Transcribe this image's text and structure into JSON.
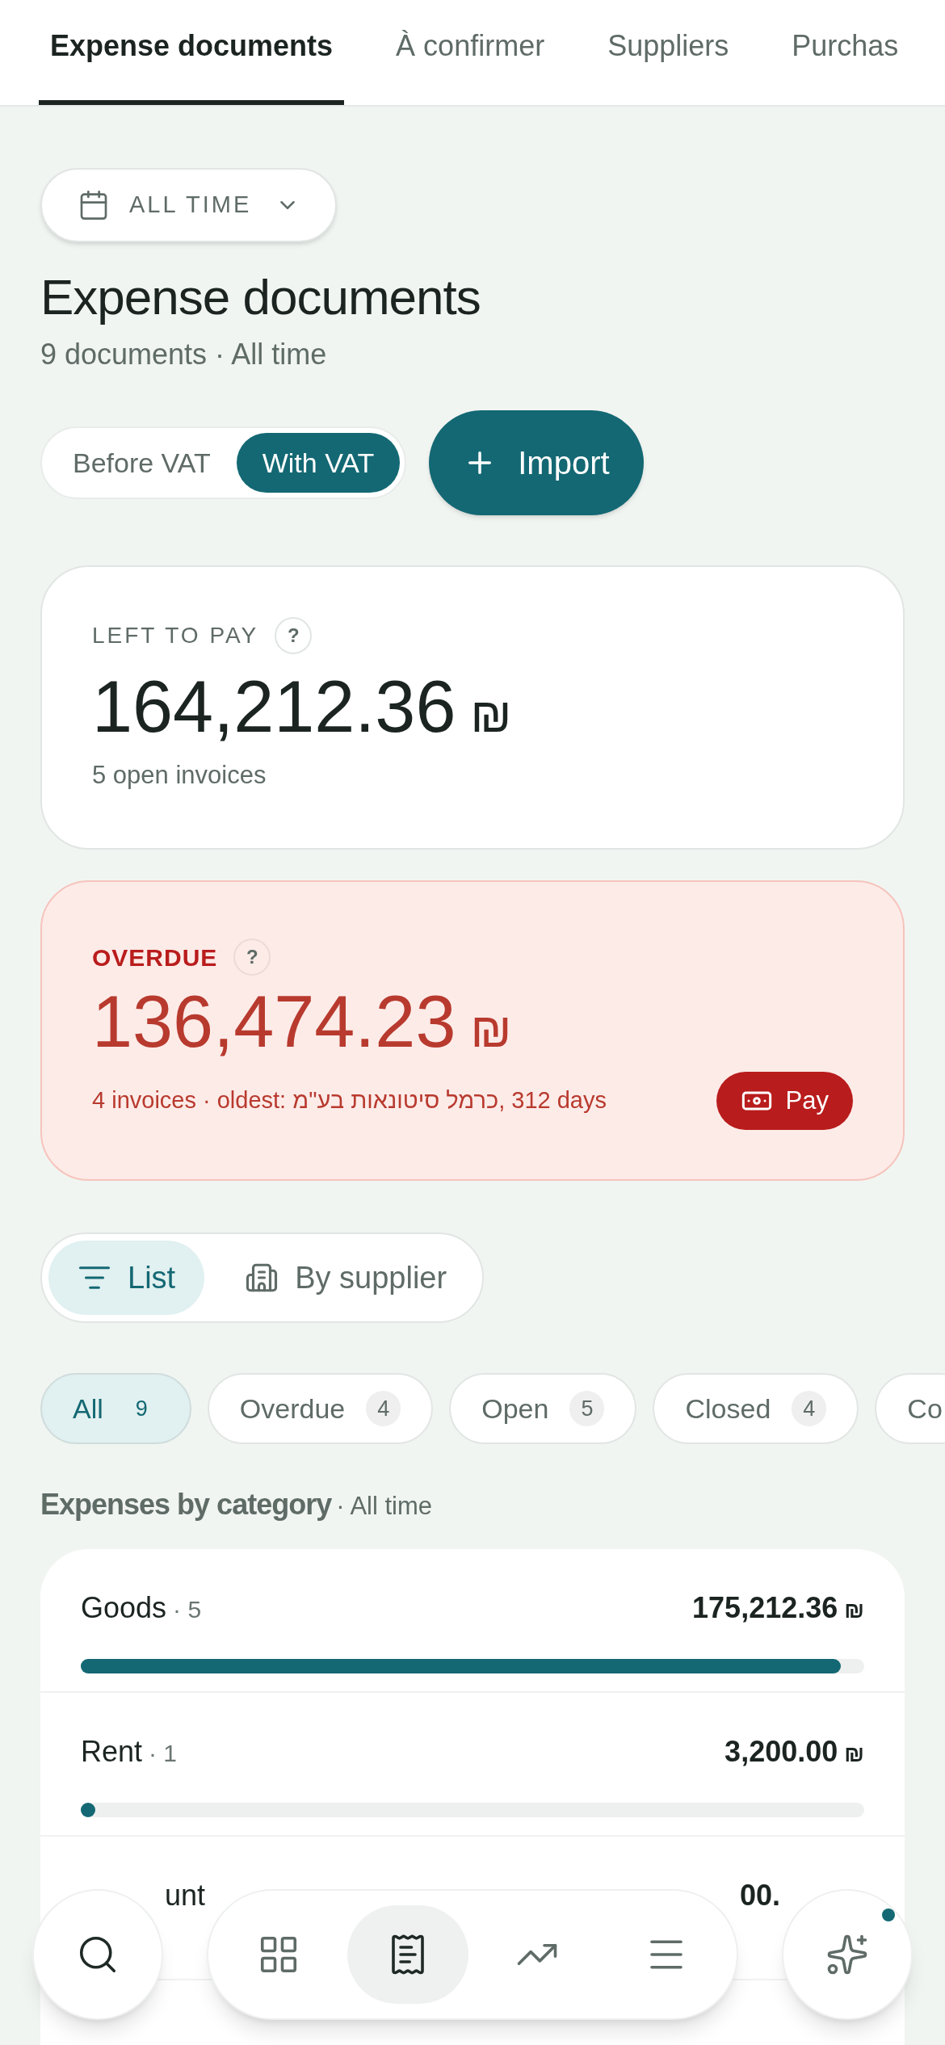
{
  "tabs": [
    {
      "label": "Expense documents",
      "selected": true
    },
    {
      "label": "À confirmer",
      "selected": false
    },
    {
      "label": "Suppliers",
      "selected": false
    },
    {
      "label": "Purchas",
      "selected": false
    }
  ],
  "date_filter": {
    "label": "ALL TIME"
  },
  "title": "Expense documents",
  "subtitle": "9 documents · All time",
  "vat_toggle": [
    {
      "label": "Before VAT",
      "selected": false
    },
    {
      "label": "With VAT",
      "selected": true
    }
  ],
  "import_button": {
    "label": "Import"
  },
  "left_to_pay": {
    "label": "LEFT TO PAY",
    "help": "?",
    "amount": "164,212.36",
    "currency": "₪",
    "note": "5 open invoices"
  },
  "overdue": {
    "label": "OVERDUE",
    "help": "?",
    "amount": "136,474.23",
    "currency": "₪",
    "note": "4 invoices · oldest: כרמל סיטונאות בע\"מ‎, 312 days",
    "pay_button": "Pay"
  },
  "view_toggle": [
    {
      "kind": "list",
      "label": "List",
      "selected": true
    },
    {
      "kind": "supplier",
      "label": "By supplier",
      "selected": false
    }
  ],
  "filters": [
    {
      "label": "All",
      "count": "9",
      "selected": true
    },
    {
      "label": "Overdue",
      "count": "4",
      "selected": false
    },
    {
      "label": "Open",
      "count": "5",
      "selected": false
    },
    {
      "label": "Closed",
      "count": "4",
      "selected": false
    },
    {
      "label": "Co",
      "selected": false
    }
  ],
  "categories": {
    "title": "Expenses by category",
    "period": "· All time",
    "items": [
      {
        "name": "Goods",
        "count": "· 5",
        "amount": "175,212.36",
        "currency": "₪",
        "level": 0.97
      },
      {
        "name": "Rent",
        "count": "· 1",
        "amount": "3,200.00",
        "currency": "₪",
        "level": 0.018
      },
      {
        "name": "unt",
        "amount": "00."
      }
    ]
  },
  "bottom_nav": [
    {
      "kind": "search",
      "selected": false
    },
    {
      "kind": "dashboard",
      "selected": false
    },
    {
      "kind": "receipt",
      "selected": true
    },
    {
      "kind": "trend",
      "selected": false
    },
    {
      "kind": "menu",
      "selected": false
    },
    {
      "kind": "assistant",
      "selected": false,
      "notification": true
    }
  ]
}
